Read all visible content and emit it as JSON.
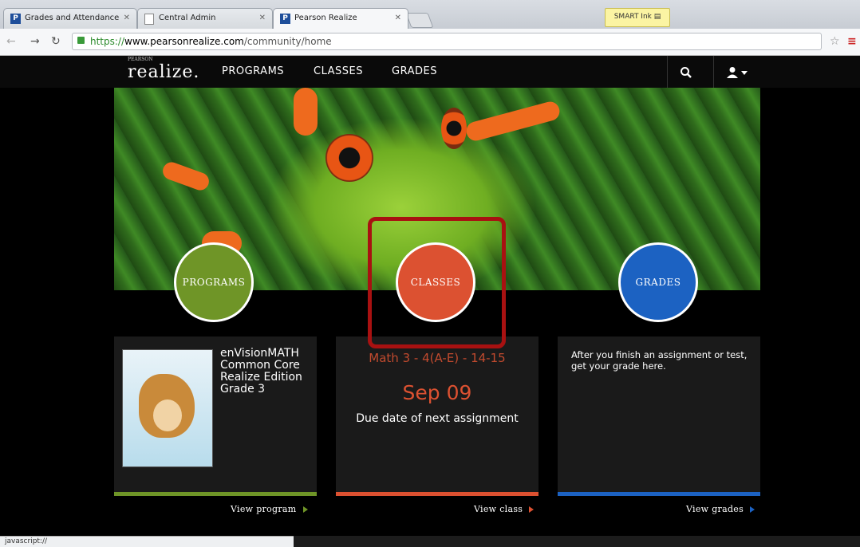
{
  "browser": {
    "tabs": [
      {
        "label": "Grades and Attendance",
        "icon": "pearson-favicon"
      },
      {
        "label": "Central Admin",
        "icon": "document-icon"
      },
      {
        "label": "Pearson Realize",
        "icon": "pearson-favicon"
      }
    ],
    "extension_label": "SMART Ink",
    "url_scheme": "https://",
    "url_domain": "www.pearsonrealize.com",
    "url_path": "/community/home",
    "status_text": "javascript://"
  },
  "site": {
    "logo_sup": "PEARSON",
    "logo": "realize.",
    "nav": [
      "PROGRAMS",
      "CLASSES",
      "GRADES"
    ]
  },
  "circles": {
    "programs": "PROGRAMS",
    "classes": "CLASSES",
    "grades": "GRADES"
  },
  "program_card": {
    "title": "enVisionMATH Common Core Realize Edition Grade 3",
    "link": "View program"
  },
  "class_card": {
    "class_name": "Math 3 - 4(A-E) - 14-15",
    "date": "Sep 09",
    "caption": "Due date of next assignment",
    "link": "View class"
  },
  "grades_card": {
    "text": "After you finish an assignment or test, get your grade here.",
    "link": "View grades"
  },
  "colors": {
    "programs": "#6f9527",
    "classes": "#dc5131",
    "grades": "#1c62c2",
    "highlight": "#a81111"
  }
}
